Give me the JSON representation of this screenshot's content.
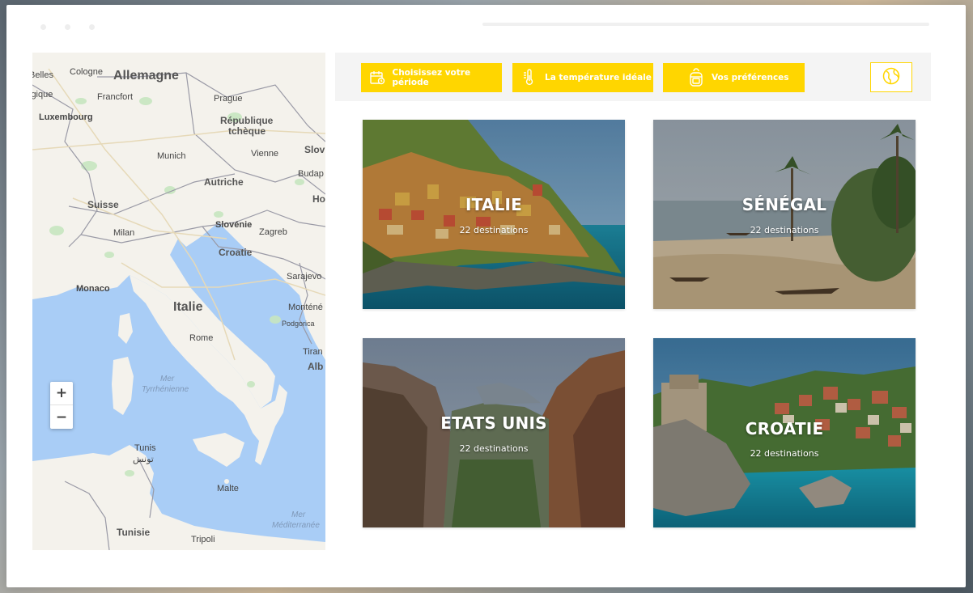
{
  "map": {
    "countries": [
      "Allemagne",
      "République",
      "tchèque",
      "Autriche",
      "Suisse",
      "Slovénie",
      "Croatie",
      "Italie",
      "Tunisie"
    ],
    "cities": [
      "Cologne",
      "Francfort",
      "Prague",
      "Luxembourg",
      "Munich",
      "Vienne",
      "Budap",
      "Ho",
      "Zagreb",
      "Milan",
      "Monaco",
      "Sarajevo",
      "Monténé",
      "Podgorica",
      "Rome",
      "Tiran",
      "Alb",
      "Tunis",
      "تونس",
      "Malte",
      "Tripoli",
      "Slov",
      "Belles",
      "lgique"
    ],
    "seas": [
      "Mer",
      "Tyrrhénienne",
      "Mer",
      "Méditerranée"
    ],
    "zoom_in": "+",
    "zoom_out": "−"
  },
  "toolbar": {
    "period_label": "Choisissez votre période",
    "temperature_label": "La température idéale",
    "preferences_label": "Vos préférences",
    "period_icon": "calendar-icon",
    "temperature_icon": "thermometer-icon",
    "preferences_icon": "backpack-icon",
    "globe_icon": "globe-icon"
  },
  "colors": {
    "accent": "#ffd600"
  },
  "destinations": [
    {
      "title": "ITALIE",
      "subtitle": "22 destinations"
    },
    {
      "title": "SÉNÉGAL",
      "subtitle": "22 destinations"
    },
    {
      "title": "ETATS UNIS",
      "subtitle": "22 destinations"
    },
    {
      "title": "CROATIE",
      "subtitle": "22 destinations"
    }
  ]
}
